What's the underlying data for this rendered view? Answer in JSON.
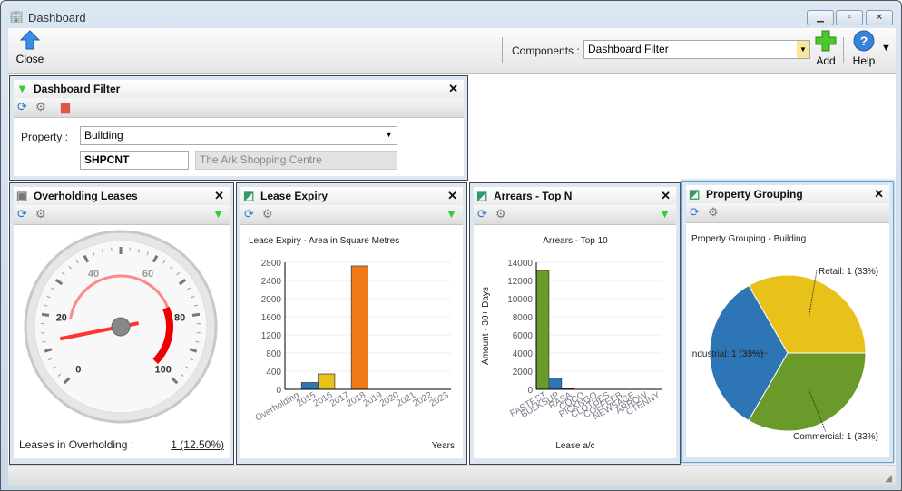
{
  "window": {
    "title": "Dashboard",
    "icon": "building-icon"
  },
  "toolbar": {
    "close_label": "Close",
    "components_label": "Components :",
    "components_value": "Dashboard Filter",
    "add_label": "Add",
    "help_label": "Help"
  },
  "filter": {
    "title": "Dashboard Filter",
    "property_label": "Property :",
    "property_value": "Building",
    "code_value": "SHPCNT",
    "name_value": "The Ark Shopping Centre"
  },
  "overholding": {
    "title": "Overholding Leases",
    "footer_label": "Leases in Overholding :",
    "footer_value": "1 (12.50%)",
    "gauge_value": 12.5,
    "gauge_ticks": [
      "0",
      "20",
      "40",
      "60",
      "80",
      "100"
    ]
  },
  "lease_expiry": {
    "title": "Lease Expiry"
  },
  "arrears": {
    "title": "Arrears - Top N"
  },
  "grouping": {
    "title": "Property Grouping"
  },
  "colors": {
    "blue": "#2e75b6",
    "yellow": "#e8c21a",
    "orange": "#f07a1a",
    "green": "#6a9a2a",
    "accent": "#d32020"
  },
  "chart_data": [
    {
      "type": "bar",
      "title": "Lease Expiry - Area in Square Metres",
      "xlabel": "Years",
      "ylabel": "",
      "ylim": [
        0,
        2800
      ],
      "yticks": [
        0,
        400,
        800,
        1200,
        1600,
        2000,
        2400,
        2800
      ],
      "categories": [
        "Overholding",
        "2015",
        "2016",
        "2017",
        "2018",
        "2019",
        "2020",
        "2021",
        "2022",
        "2023"
      ],
      "values": [
        0,
        150,
        340,
        0,
        2720,
        0,
        0,
        0,
        0,
        0
      ],
      "bar_colors": [
        "#2e75b6",
        "#2e75b6",
        "#e8c21a",
        "#f07a1a",
        "#f07a1a",
        "#f07a1a",
        "#f07a1a",
        "#f07a1a",
        "#f07a1a",
        "#f07a1a"
      ],
      "grid": true
    },
    {
      "type": "bar",
      "title": "Arrears - Top 10",
      "xlabel": "Lease a/c",
      "ylabel": "Amount - 30+ Days",
      "ylim": [
        0,
        14000
      ],
      "yticks": [
        0,
        2000,
        4000,
        6000,
        8000,
        10000,
        12000,
        14000
      ],
      "categories": [
        "FASTEST",
        "BULKSUP",
        "RASA",
        "COCO",
        "PICKNGO",
        "CLOTHES",
        "COFFEEB",
        "NEWSAGE",
        "ARROW",
        "CTENNY"
      ],
      "values": [
        13100,
        1250,
        80,
        0,
        0,
        0,
        0,
        0,
        0,
        0
      ],
      "bar_colors": [
        "#6a9a2a",
        "#2e75b6",
        "#2e75b6",
        "#2e75b6",
        "#2e75b6",
        "#2e75b6",
        "#2e75b6",
        "#2e75b6",
        "#2e75b6",
        "#2e75b6"
      ],
      "grid": true
    },
    {
      "type": "pie",
      "title": "Property Grouping - Building",
      "slices": [
        {
          "label": "Retail: 1 (33%)",
          "value": 1,
          "color": "#e8c21a"
        },
        {
          "label": "Industrial: 1 (33%)",
          "value": 1,
          "color": "#2e75b6"
        },
        {
          "label": "Commercial: 1 (33%)",
          "value": 1,
          "color": "#6a9a2a"
        }
      ]
    }
  ]
}
